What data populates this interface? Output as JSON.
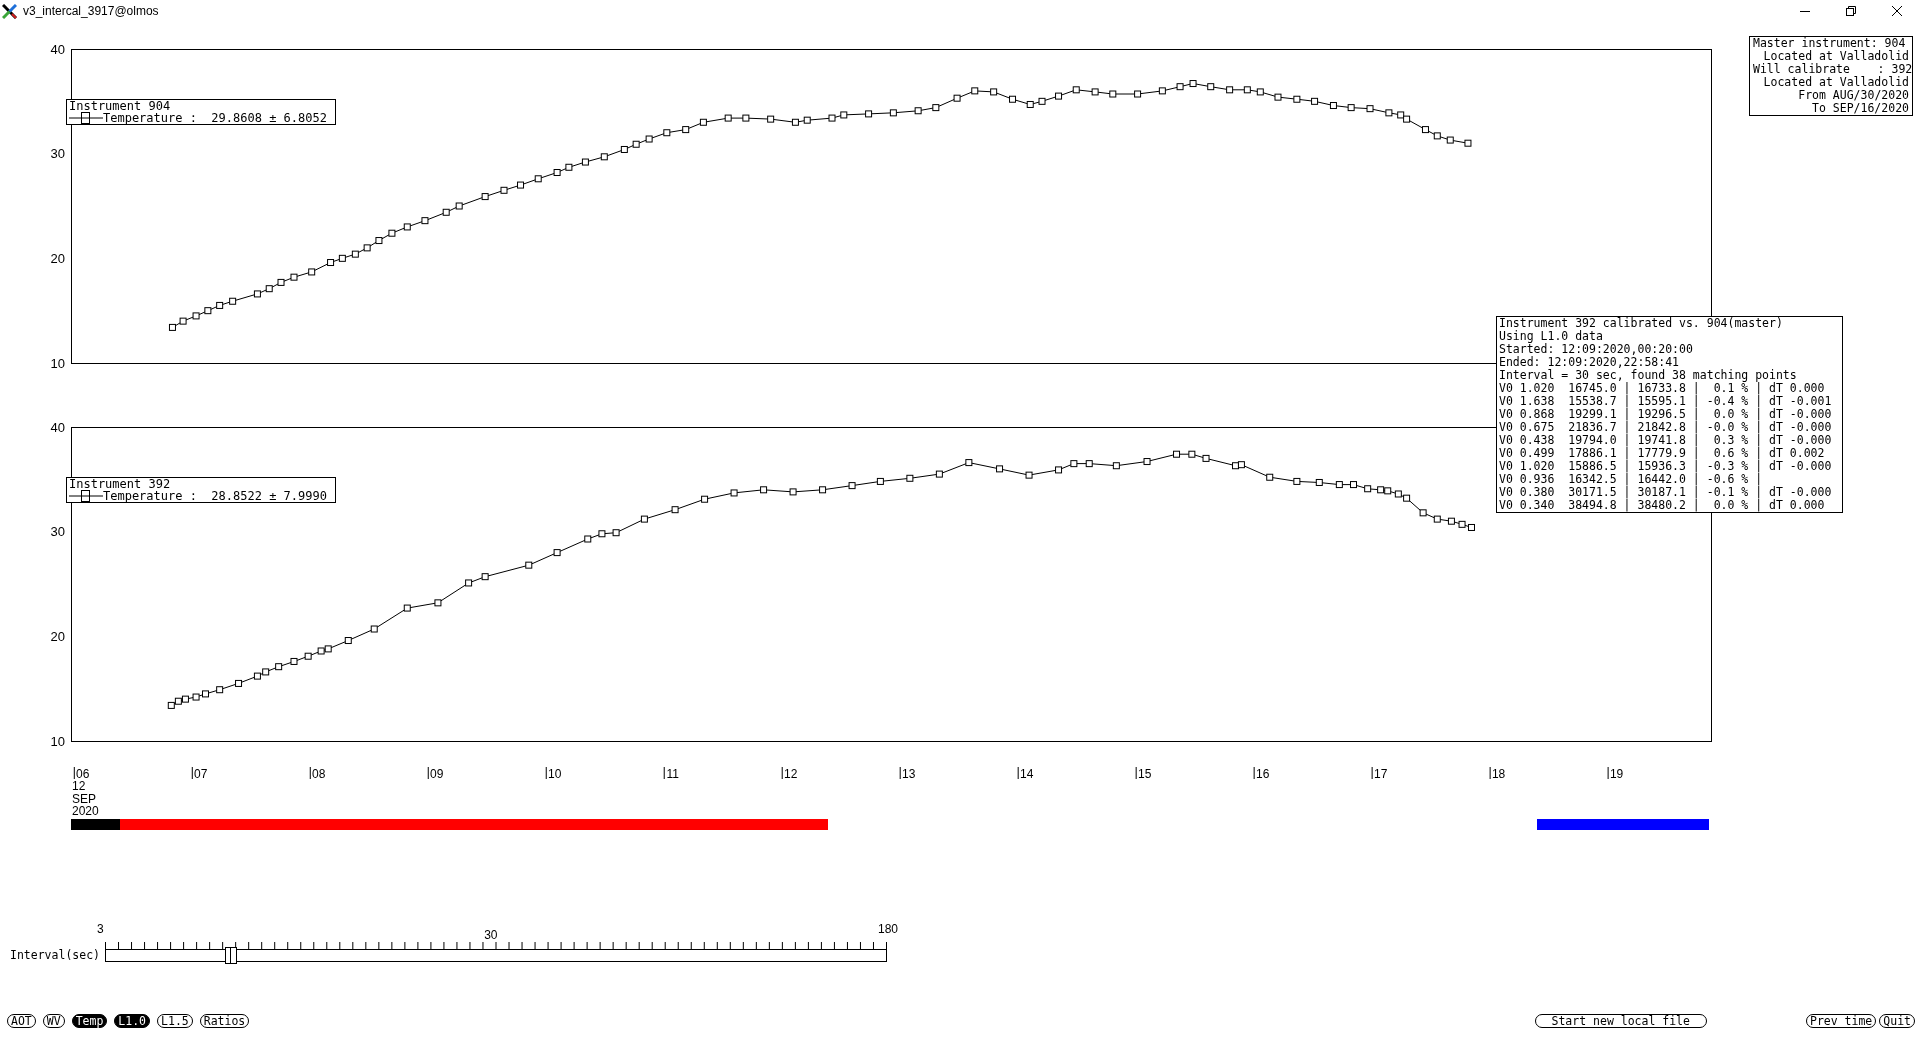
{
  "window": {
    "title": "v3_intercal_3917@olmos"
  },
  "charts": [
    {
      "legend": {
        "title": "Instrument 904",
        "entry": "Temperature :  29.8608 ± 6.8052"
      },
      "chart_data": {
        "type": "line",
        "marker": "square",
        "xlim": [
          5.9,
          19.8
        ],
        "ylim": [
          10,
          40
        ],
        "yticks": [
          10,
          20,
          30,
          40
        ],
        "x": [
          6.76,
          6.85,
          6.96,
          7.06,
          7.16,
          7.27,
          7.48,
          7.58,
          7.68,
          7.79,
          7.94,
          8.1,
          8.2,
          8.31,
          8.41,
          8.51,
          8.62,
          8.75,
          8.9,
          9.08,
          9.19,
          9.41,
          9.57,
          9.71,
          9.86,
          10.02,
          10.12,
          10.26,
          10.42,
          10.59,
          10.69,
          10.8,
          10.95,
          11.11,
          11.26,
          11.47,
          11.62,
          11.83,
          12.04,
          12.14,
          12.35,
          12.45,
          12.66,
          12.87,
          13.08,
          13.23,
          13.41,
          13.56,
          13.72,
          13.88,
          14.03,
          14.13,
          14.27,
          14.42,
          14.58,
          14.73,
          14.94,
          15.15,
          15.3,
          15.41,
          15.56,
          15.72,
          15.87,
          15.98,
          16.13,
          16.29,
          16.44,
          16.6,
          16.75,
          16.91,
          17.07,
          17.17,
          17.22,
          17.38,
          17.48,
          17.59,
          17.74
        ],
        "values": [
          13.4,
          14.0,
          14.5,
          15.0,
          15.5,
          15.9,
          16.6,
          17.1,
          17.7,
          18.2,
          18.7,
          19.6,
          20.0,
          20.4,
          21.0,
          21.7,
          22.4,
          23.0,
          23.6,
          24.4,
          25.0,
          25.9,
          26.5,
          27.0,
          27.6,
          28.2,
          28.7,
          29.2,
          29.7,
          30.4,
          30.9,
          31.4,
          32.0,
          32.3,
          33.0,
          33.4,
          33.4,
          33.3,
          33.0,
          33.2,
          33.4,
          33.7,
          33.8,
          33.9,
          34.1,
          34.4,
          35.3,
          36.0,
          35.9,
          35.2,
          34.7,
          35.0,
          35.5,
          36.1,
          35.9,
          35.7,
          35.7,
          36.0,
          36.4,
          36.7,
          36.4,
          36.1,
          36.1,
          35.9,
          35.4,
          35.2,
          35.0,
          34.6,
          34.4,
          34.3,
          33.9,
          33.7,
          33.3,
          32.3,
          31.7,
          31.3,
          31.0
        ]
      }
    },
    {
      "legend": {
        "title": "Instrument 392",
        "entry": "Temperature :  28.8522 ± 7.9990"
      },
      "chart_data": {
        "type": "line",
        "marker": "square",
        "xlim": [
          5.9,
          19.8
        ],
        "ylim": [
          10,
          40
        ],
        "yticks": [
          10,
          20,
          30,
          40
        ],
        "xticks": [
          {
            "value": 6,
            "label": "06"
          },
          {
            "value": 7,
            "label": "07"
          },
          {
            "value": 8,
            "label": "08"
          },
          {
            "value": 9,
            "label": "09"
          },
          {
            "value": 10,
            "label": "10"
          },
          {
            "value": 11,
            "label": "11"
          },
          {
            "value": 12,
            "label": "12"
          },
          {
            "value": 13,
            "label": "13"
          },
          {
            "value": 14,
            "label": "14"
          },
          {
            "value": 15,
            "label": "15"
          },
          {
            "value": 16,
            "label": "16"
          },
          {
            "value": 17,
            "label": "17"
          },
          {
            "value": 18,
            "label": "18"
          },
          {
            "value": 19,
            "label": "19"
          }
        ],
        "x": [
          6.75,
          6.81,
          6.87,
          6.96,
          7.04,
          7.16,
          7.32,
          7.48,
          7.55,
          7.66,
          7.79,
          7.91,
          8.02,
          8.08,
          8.25,
          8.47,
          8.75,
          9.01,
          9.27,
          9.41,
          9.78,
          10.02,
          10.28,
          10.4,
          10.52,
          10.76,
          11.02,
          11.27,
          11.52,
          11.77,
          12.02,
          12.27,
          12.52,
          12.76,
          13.01,
          13.26,
          13.51,
          13.77,
          14.02,
          14.27,
          14.4,
          14.53,
          14.76,
          15.02,
          15.27,
          15.4,
          15.52,
          15.77,
          15.82,
          16.06,
          16.29,
          16.48,
          16.65,
          16.77,
          16.89,
          17.0,
          17.06,
          17.15,
          17.22,
          17.36,
          17.48,
          17.6,
          17.69,
          17.77
        ],
        "values": [
          13.4,
          13.8,
          14.0,
          14.2,
          14.5,
          14.9,
          15.5,
          16.2,
          16.6,
          17.1,
          17.6,
          18.1,
          18.6,
          18.8,
          19.6,
          20.7,
          22.7,
          23.2,
          25.1,
          25.7,
          26.8,
          28.0,
          29.3,
          29.8,
          29.9,
          31.2,
          32.1,
          33.1,
          33.7,
          34.0,
          33.8,
          34.0,
          34.4,
          34.8,
          35.1,
          35.5,
          36.6,
          36.0,
          35.4,
          35.9,
          36.5,
          36.5,
          36.3,
          36.7,
          37.4,
          37.4,
          37.0,
          36.3,
          36.4,
          35.2,
          34.8,
          34.7,
          34.5,
          34.5,
          34.1,
          34.0,
          33.9,
          33.6,
          33.2,
          31.8,
          31.2,
          31.0,
          30.7,
          30.4
        ]
      },
      "axis_date": [
        "12",
        "SEP",
        "2020"
      ]
    }
  ],
  "coverage_bars": [
    {
      "color": "#000000"
    },
    {
      "color": "#ff0000"
    },
    {
      "color": "#0000ff"
    }
  ],
  "info_box": [
    "Master instrument: 904",
    "Located at Valladolid",
    "Will calibrate    : 392",
    "Located at Valladolid",
    "From AUG/30/2020",
    "To SEP/16/2020"
  ],
  "calibration_report": [
    "Instrument 392 calibrated vs. 904(master)",
    "Using L1.0 data",
    "Started: 12:09:2020,00:20:00",
    "Ended: 12:09:2020,22:58:41",
    "Interval = 30 sec, found 38 matching points",
    "V0 1.020  16745.0 | 16733.8 |  0.1 % | dT 0.000",
    "V0 1.638  15538.7 | 15595.1 | -0.4 % | dT -0.001",
    "V0 0.868  19299.1 | 19296.5 |  0.0 % | dT -0.000",
    "V0 0.675  21836.7 | 21842.8 | -0.0 % | dT -0.000",
    "V0 0.438  19794.0 | 19741.8 |  0.3 % | dT -0.000",
    "V0 0.499  17886.1 | 17779.9 |  0.6 % | dT 0.002",
    "V0 1.020  15886.5 | 15936.3 | -0.3 % | dT -0.000",
    "V0 0.936  16342.5 | 16442.0 | -0.6 % |",
    "V0 0.380  30171.5 | 30187.1 | -0.1 % | dT -0.000",
    "V0 0.340  38494.8 | 38480.2 |  0.0 % | dT 0.000"
  ],
  "interval_slider": {
    "label": "Interval(sec)",
    "scale_labels": [
      "3",
      "30",
      "180"
    ],
    "level": 0.16
  },
  "mode_buttons": [
    {
      "label": "AOT",
      "selected": false
    },
    {
      "label": "WV",
      "selected": false
    },
    {
      "label": "Temp",
      "selected": true
    },
    {
      "label": "L1.0",
      "selected": true
    },
    {
      "label": "L1.5",
      "selected": false
    },
    {
      "label": "Ratios",
      "selected": false
    }
  ],
  "file_button": "Start new local file",
  "nav_buttons": [
    "Prev time",
    "Quit"
  ]
}
